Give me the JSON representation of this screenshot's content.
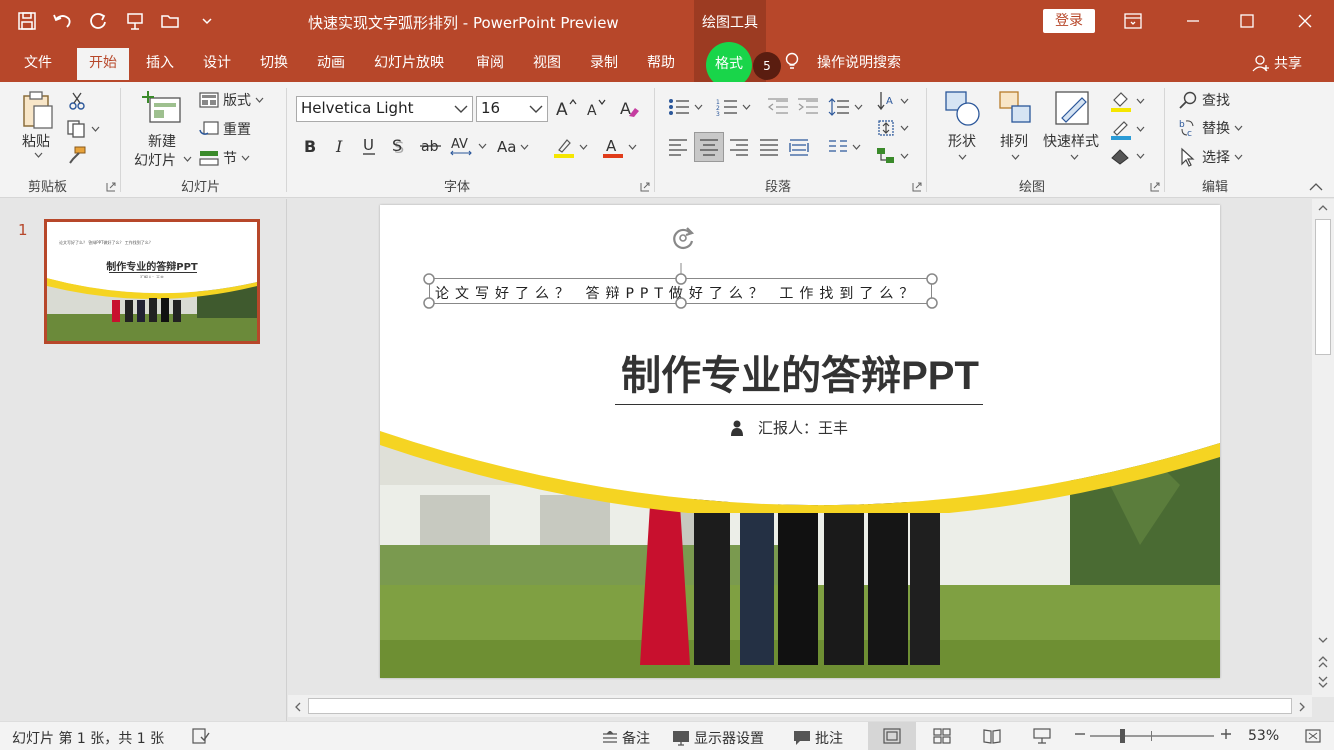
{
  "window": {
    "title": "快速实现文字弧形排列 - PowerPoint Preview",
    "contextual_tab_group": "绘图工具",
    "login_label": "登录",
    "share_label": "共享"
  },
  "tabs": [
    {
      "label": "文件"
    },
    {
      "label": "开始"
    },
    {
      "label": "插入"
    },
    {
      "label": "设计"
    },
    {
      "label": "切换"
    },
    {
      "label": "动画"
    },
    {
      "label": "幻灯片放映"
    },
    {
      "label": "审阅"
    },
    {
      "label": "视图"
    },
    {
      "label": "录制"
    },
    {
      "label": "帮助"
    },
    {
      "label": "格式"
    },
    {
      "label": "操作说明搜索"
    }
  ],
  "step_badge": "5",
  "ribbon": {
    "clipboard": {
      "group_label": "剪贴板",
      "paste_label": "粘贴"
    },
    "slides": {
      "group_label": "幻灯片",
      "new_slide_label_1": "新建",
      "new_slide_label_2": "幻灯片",
      "layout_label": "版式",
      "reset_label": "重置",
      "section_label": "节"
    },
    "font": {
      "group_label": "字体",
      "font_name": "Helvetica Light",
      "font_size": "16",
      "case_label": "Aa"
    },
    "paragraph": {
      "group_label": "段落"
    },
    "drawing": {
      "group_label": "绘图",
      "shapes_label": "形状",
      "arrange_label": "排列",
      "quick_styles_label": "快速样式"
    },
    "editing": {
      "group_label": "编辑",
      "find_label": "查找",
      "replace_label": "替换",
      "select_label": "选择"
    }
  },
  "thumbnail": {
    "number": "1",
    "top_text": "论文写好了么？  答辩PPT做好了么？  工作找到了么？",
    "title": "制作专业的答辩PPT",
    "reporter": "汇报人：王丰"
  },
  "slide": {
    "textbox_text": "论文写好了么？  答辩PPT做好了么？  工作找到了么？",
    "title": "制作专业的答辩PPT",
    "reporter": "汇报人：王丰"
  },
  "statusbar": {
    "slide_info": "幻灯片 第 1 张，共 1 张",
    "notes_label": "备注",
    "display_settings_label": "显示器设置",
    "comments_label": "批注",
    "zoom_value": "53%"
  },
  "colors": {
    "accent": "#b7472a",
    "highlight_green": "#19d54a",
    "slide_yellow": "#f5d422"
  }
}
